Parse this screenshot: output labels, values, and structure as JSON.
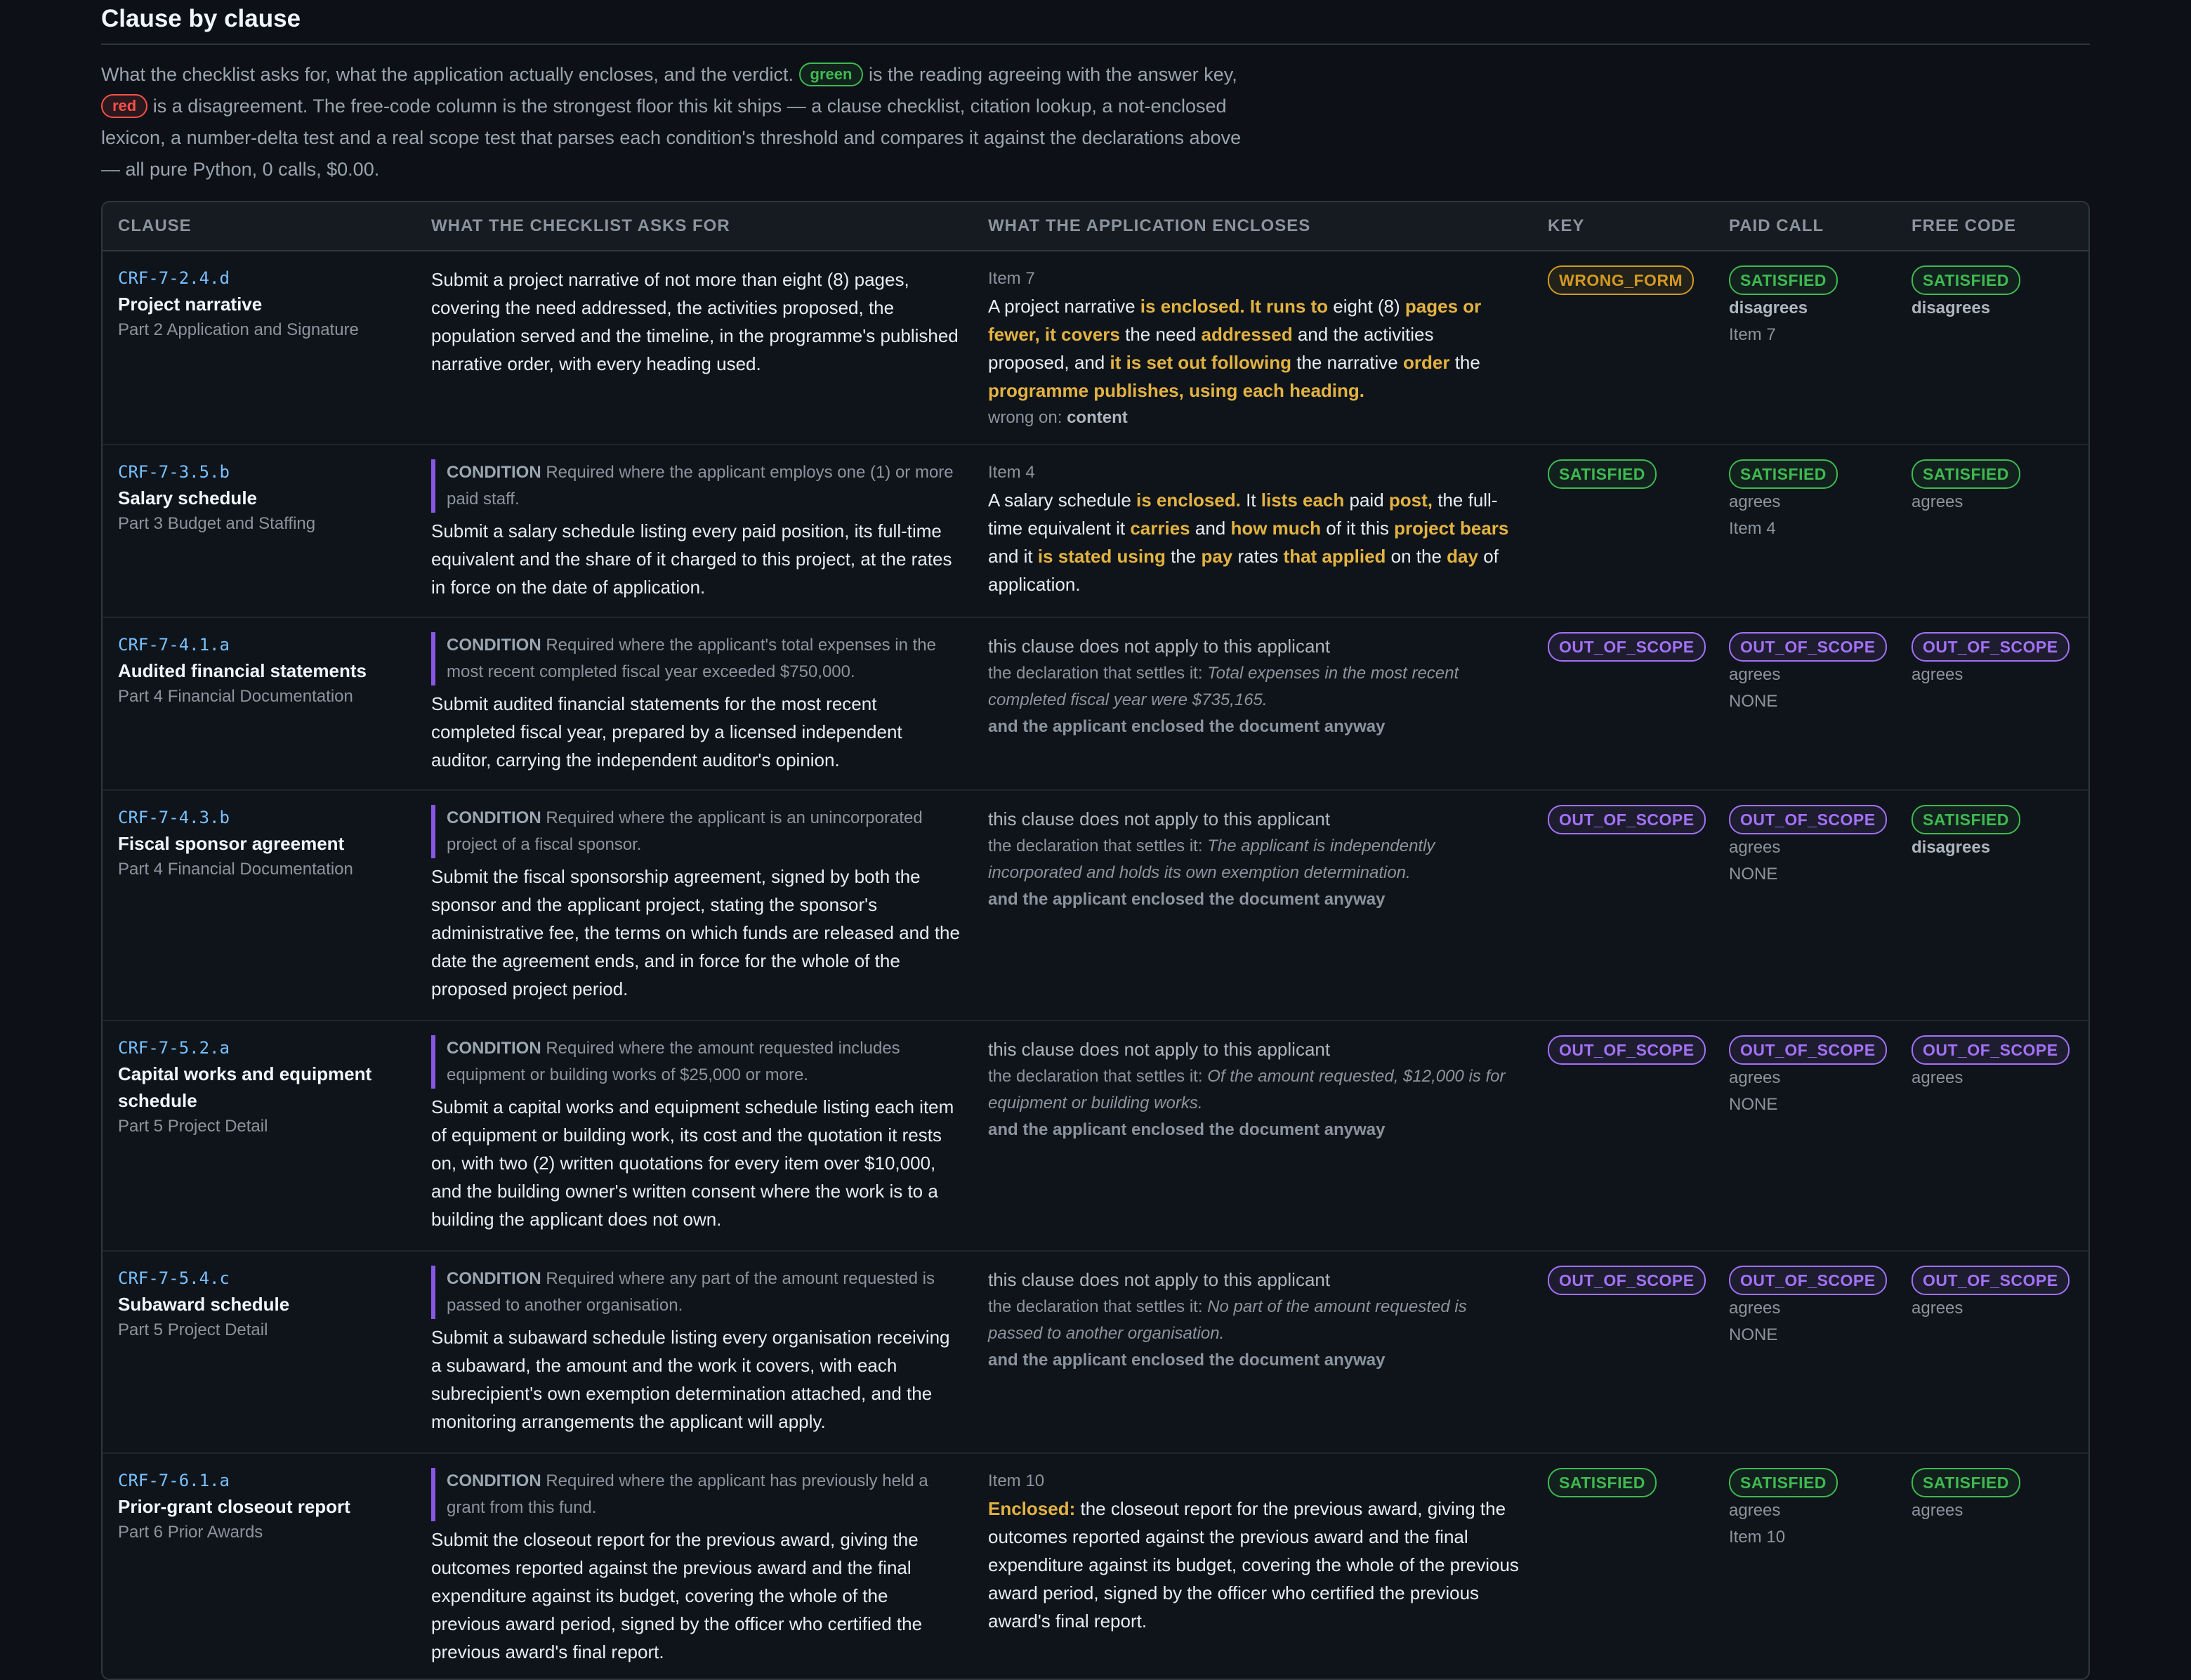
{
  "section": {
    "title": "Clause by clause",
    "intro": {
      "part1": "What the checklist asks for, what the application actually encloses, and the verdict.",
      "green_chip": "green",
      "part2": "is the reading agreeing with the answer key,",
      "red_chip": "red",
      "part3": "is a disagreement. The free-code column is the strongest floor this kit ships — a clause checklist, citation lookup, a not-enclosed lexicon, a number-delta test and a real scope test that parses each condition's threshold and compares it against the declarations above — all pure Python, 0 calls, $0.00."
    }
  },
  "table": {
    "headers": {
      "clause": "CLAUSE",
      "asks": "WHAT THE CHECKLIST ASKS FOR",
      "encloses": "WHAT THE APPLICATION ENCLOSES",
      "key": "KEY",
      "paid": "PAID CALL",
      "free": "FREE CODE"
    },
    "condition_label": "CONDITION",
    "not_apply": "this clause does not apply to this applicant",
    "settles_label": "the declaration that settles it:",
    "enclosed_anyway": "and the applicant enclosed the document anyway",
    "rows": [
      {
        "code": "CRF-7-2.4.d",
        "name": "Project narrative",
        "part": "Part 2 Application and Signature",
        "condition": "",
        "asks": "Submit a project narrative of not more than eight (8) pages, covering the need addressed, the activities proposed, the population served and the timeline, in the programme's published narrative order, with every heading used.",
        "item": "Item 7",
        "enclosed_segments": [
          "A project narrative ",
          "is enclosed. It runs to",
          " eight (8) ",
          "pages or fewer, it covers",
          " the need ",
          "addressed",
          " and the activities proposed, and ",
          "it is set out following",
          " the narrative ",
          "order",
          " the ",
          "programme publishes, using each heading."
        ],
        "wrong_on_label": "wrong on:",
        "wrong_on": "content",
        "key": "WRONG_FORM",
        "paid": "SATISFIED",
        "paid_verdict": "disagrees",
        "paid_sub": "Item 7",
        "free": "SATISFIED",
        "free_verdict": "disagrees"
      },
      {
        "code": "CRF-7-3.5.b",
        "name": "Salary schedule",
        "part": "Part 3 Budget and Staffing",
        "condition": "Required where the applicant employs one (1) or more paid staff.",
        "asks": "Submit a salary schedule listing every paid position, its full-time equivalent and the share of it charged to this project, at the rates in force on the date of application.",
        "item": "Item 4",
        "enclosed_segments": [
          "A salary schedule ",
          "is enclosed.",
          " It ",
          "lists each",
          " paid ",
          "post,",
          " the full-time equivalent it ",
          "carries",
          " and ",
          "how much",
          " of it this ",
          "project bears",
          " and it ",
          "is stated using",
          " the ",
          "pay",
          " rates ",
          "that applied",
          " on the ",
          "day",
          " of application."
        ],
        "key": "SATISFIED",
        "paid": "SATISFIED",
        "paid_verdict": "agrees",
        "paid_sub": "Item 4",
        "free": "SATISFIED",
        "free_verdict": "agrees"
      },
      {
        "code": "CRF-7-4.1.a",
        "name": "Audited financial statements",
        "part": "Part 4 Financial Documentation",
        "condition": "Required where the applicant's total expenses in the most recent completed fiscal year exceeded $750,000.",
        "asks": "Submit audited financial statements for the most recent completed fiscal year, prepared by a licensed independent auditor, carrying the independent auditor's opinion.",
        "declaration": "Total expenses in the most recent completed fiscal year were $735,165.",
        "key": "OUT_OF_SCOPE",
        "paid": "OUT_OF_SCOPE",
        "paid_verdict": "agrees",
        "paid_sub": "NONE",
        "free": "OUT_OF_SCOPE",
        "free_verdict": "agrees"
      },
      {
        "code": "CRF-7-4.3.b",
        "name": "Fiscal sponsor agreement",
        "part": "Part 4 Financial Documentation",
        "condition": "Required where the applicant is an unincorporated project of a fiscal sponsor.",
        "asks": "Submit the fiscal sponsorship agreement, signed by both the sponsor and the applicant project, stating the sponsor's administrative fee, the terms on which funds are released and the date the agreement ends, and in force for the whole of the proposed project period.",
        "declaration": "The applicant is independently incorporated and holds its own exemption determination.",
        "key": "OUT_OF_SCOPE",
        "paid": "OUT_OF_SCOPE",
        "paid_verdict": "agrees",
        "paid_sub": "NONE",
        "free": "SATISFIED",
        "free_verdict": "disagrees"
      },
      {
        "code": "CRF-7-5.2.a",
        "name": "Capital works and equipment schedule",
        "part": "Part 5 Project Detail",
        "condition": "Required where the amount requested includes equipment or building works of $25,000 or more.",
        "asks": "Submit a capital works and equipment schedule listing each item of equipment or building work, its cost and the quotation it rests on, with two (2) written quotations for every item over $10,000, and the building owner's written consent where the work is to a building the applicant does not own.",
        "declaration": "Of the amount requested, $12,000 is for equipment or building works.",
        "key": "OUT_OF_SCOPE",
        "paid": "OUT_OF_SCOPE",
        "paid_verdict": "agrees",
        "paid_sub": "NONE",
        "free": "OUT_OF_SCOPE",
        "free_verdict": "agrees"
      },
      {
        "code": "CRF-7-5.4.c",
        "name": "Subaward schedule",
        "part": "Part 5 Project Detail",
        "condition": "Required where any part of the amount requested is passed to another organisation.",
        "asks": "Submit a subaward schedule listing every organisation receiving a subaward, the amount and the work it covers, with each subrecipient's own exemption determination attached, and the monitoring arrangements the applicant will apply.",
        "declaration": "No part of the amount requested is passed to another organisation.",
        "key": "OUT_OF_SCOPE",
        "paid": "OUT_OF_SCOPE",
        "paid_verdict": "agrees",
        "paid_sub": "NONE",
        "free": "OUT_OF_SCOPE",
        "free_verdict": "agrees"
      },
      {
        "code": "CRF-7-6.1.a",
        "name": "Prior-grant closeout report",
        "part": "Part 6 Prior Awards",
        "condition": "Required where the applicant has previously held a grant from this fund.",
        "asks": "Submit the closeout report for the previous award, giving the outcomes reported against the previous award and the final expenditure against its budget, covering the whole of the previous award period, signed by the officer who certified the previous award's final report.",
        "item": "Item 10",
        "enclosed_segments": [
          "",
          "Enclosed:",
          " the closeout report for the previous award, giving the outcomes reported against the previous award and the final expenditure against its budget, covering the whole of the previous award period, signed by the officer who certified the previous award's final report."
        ],
        "key": "SATISFIED",
        "paid": "SATISFIED",
        "paid_verdict": "agrees",
        "paid_sub": "Item 10",
        "free": "SATISFIED",
        "free_verdict": "agrees"
      }
    ]
  },
  "colors": {
    "background": "#0d1117",
    "satisfied": "#3fb950",
    "out_of_scope": "#a371f7",
    "wrong_form": "#d29922",
    "highlight": "#e3b341",
    "clause_code": "#79c0ff"
  }
}
